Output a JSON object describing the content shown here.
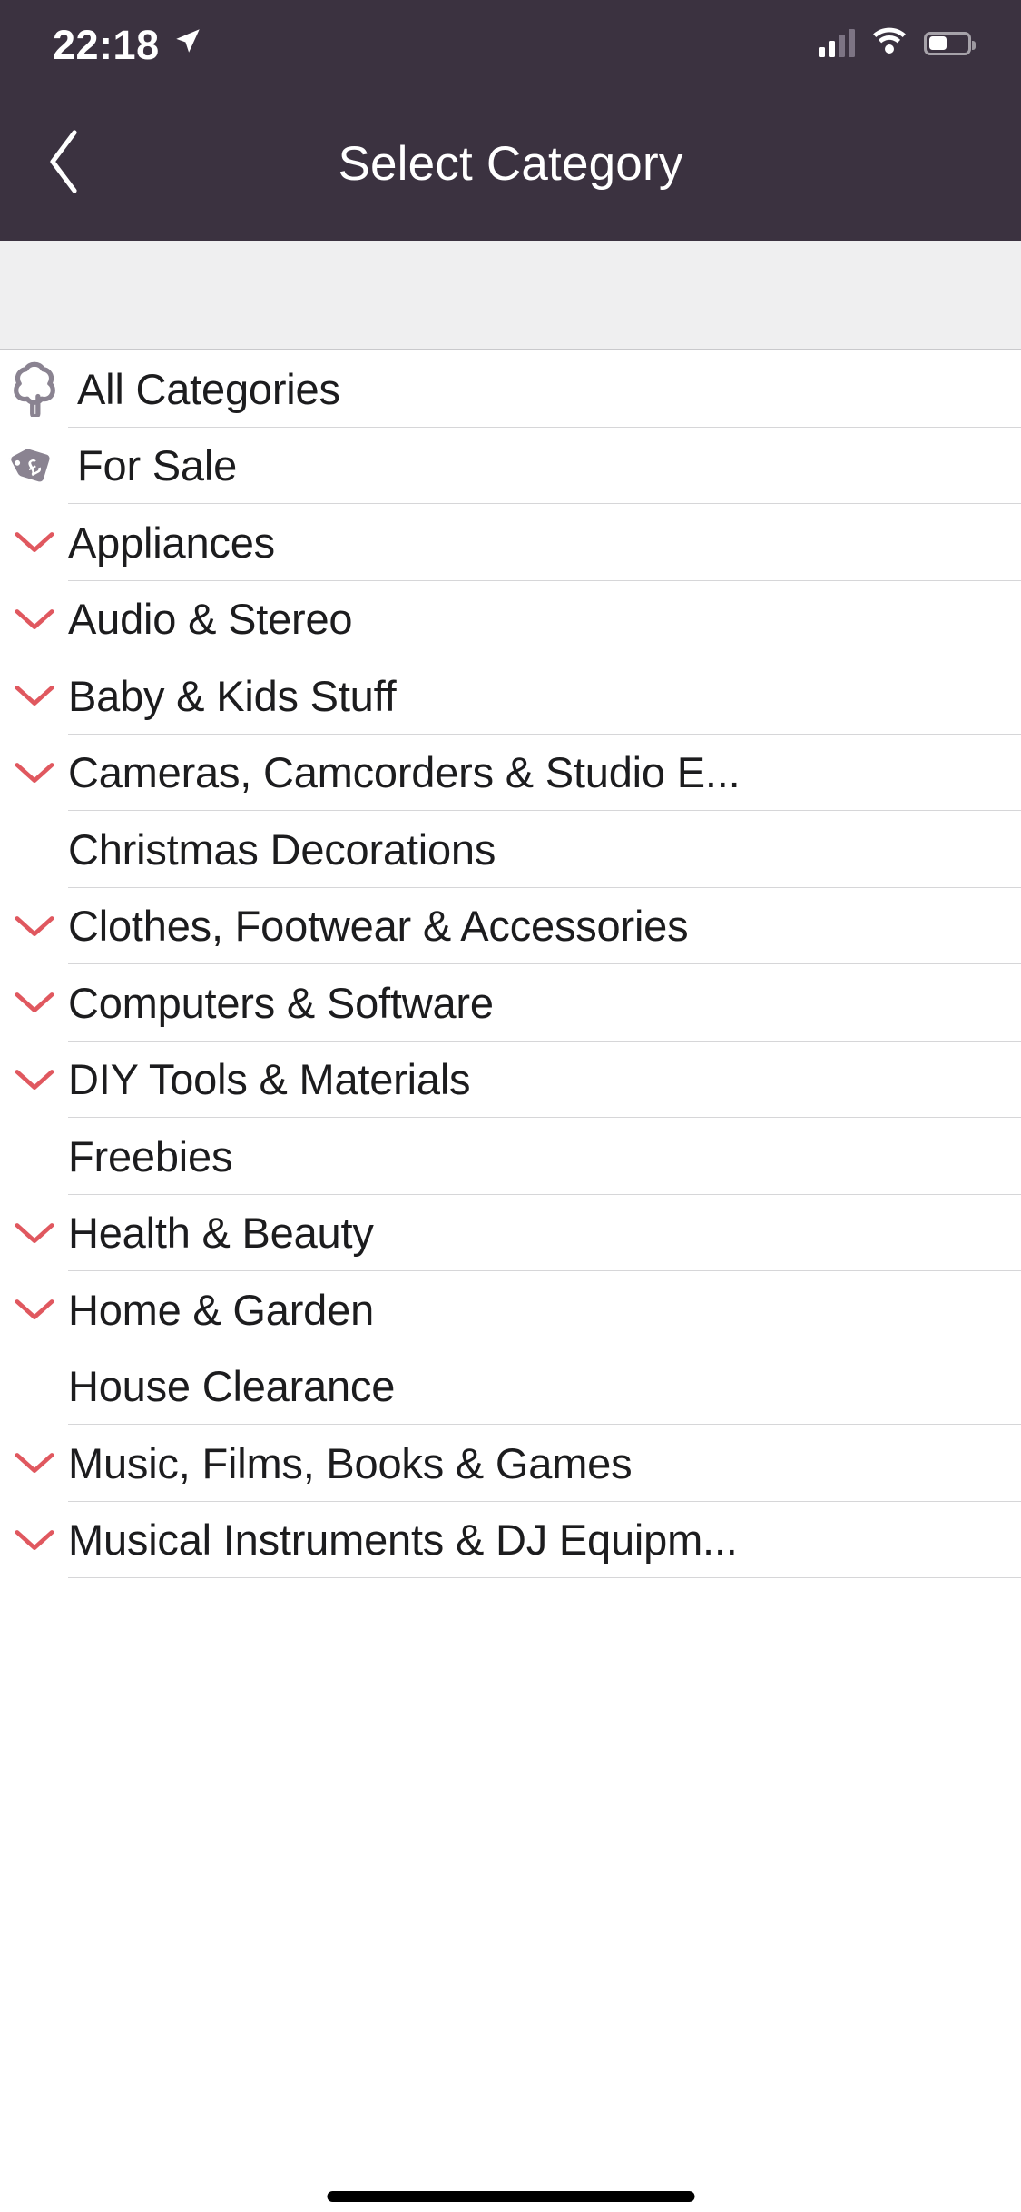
{
  "statusbar": {
    "time": "22:18",
    "location_icon": "location-arrow-icon",
    "signal_icon": "cellular-signal-icon",
    "wifi_icon": "wifi-icon",
    "battery_icon": "battery-icon"
  },
  "navbar": {
    "back_icon": "chevron-left-icon",
    "title": "Select Category"
  },
  "colors": {
    "header_bg": "#3b3240",
    "spacer_bg": "#efeff0",
    "chevron_red": "#e0585f",
    "icon_gray": "#8a8391",
    "text": "#1c1c1e",
    "separator": "#d6d6d8"
  },
  "list": {
    "top_items": [
      {
        "label": "All Categories",
        "icon": "gumtree-tree-icon",
        "has_chevron": false
      },
      {
        "label": "For Sale",
        "icon": "price-tag-pound-icon",
        "has_chevron": false
      }
    ],
    "sub_items": [
      {
        "label": "Appliances",
        "has_chevron": true
      },
      {
        "label": "Audio & Stereo",
        "has_chevron": true
      },
      {
        "label": "Baby & Kids Stuff",
        "has_chevron": true
      },
      {
        "label": "Cameras, Camcorders & Studio E...",
        "has_chevron": true
      },
      {
        "label": "Christmas Decorations",
        "has_chevron": false
      },
      {
        "label": "Clothes, Footwear & Accessories",
        "has_chevron": true
      },
      {
        "label": "Computers & Software",
        "has_chevron": true
      },
      {
        "label": "DIY Tools & Materials",
        "has_chevron": true
      },
      {
        "label": "Freebies",
        "has_chevron": false
      },
      {
        "label": "Health & Beauty",
        "has_chevron": true
      },
      {
        "label": "Home & Garden",
        "has_chevron": true
      },
      {
        "label": "House Clearance",
        "has_chevron": false
      },
      {
        "label": "Music, Films, Books & Games",
        "has_chevron": true
      },
      {
        "label": "Musical Instruments & DJ Equipm...",
        "has_chevron": true
      }
    ]
  }
}
